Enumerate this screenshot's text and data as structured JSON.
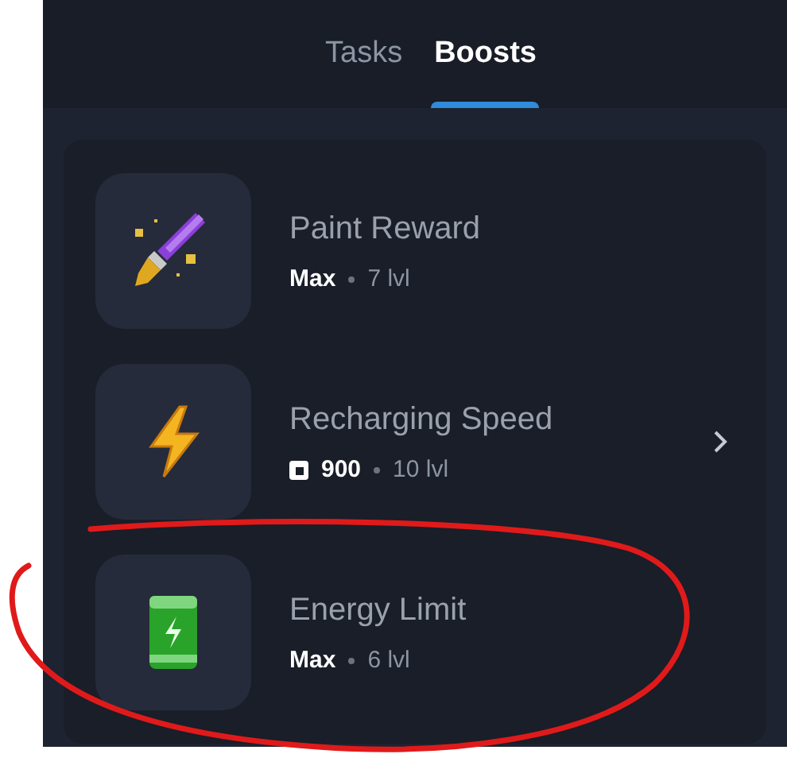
{
  "tabs": [
    {
      "label": "Tasks",
      "selected": false
    },
    {
      "label": "Boosts",
      "selected": true
    }
  ],
  "boosts": [
    {
      "name": "Paint Reward",
      "kind": "max",
      "status": "Max",
      "level": "7 lvl",
      "arrow": false
    },
    {
      "name": "Recharging Speed",
      "kind": "price",
      "status": "900",
      "level": "10 lvl",
      "arrow": true
    },
    {
      "name": "Energy Limit",
      "kind": "max",
      "status": "Max",
      "level": "6 lvl",
      "arrow": false
    }
  ]
}
